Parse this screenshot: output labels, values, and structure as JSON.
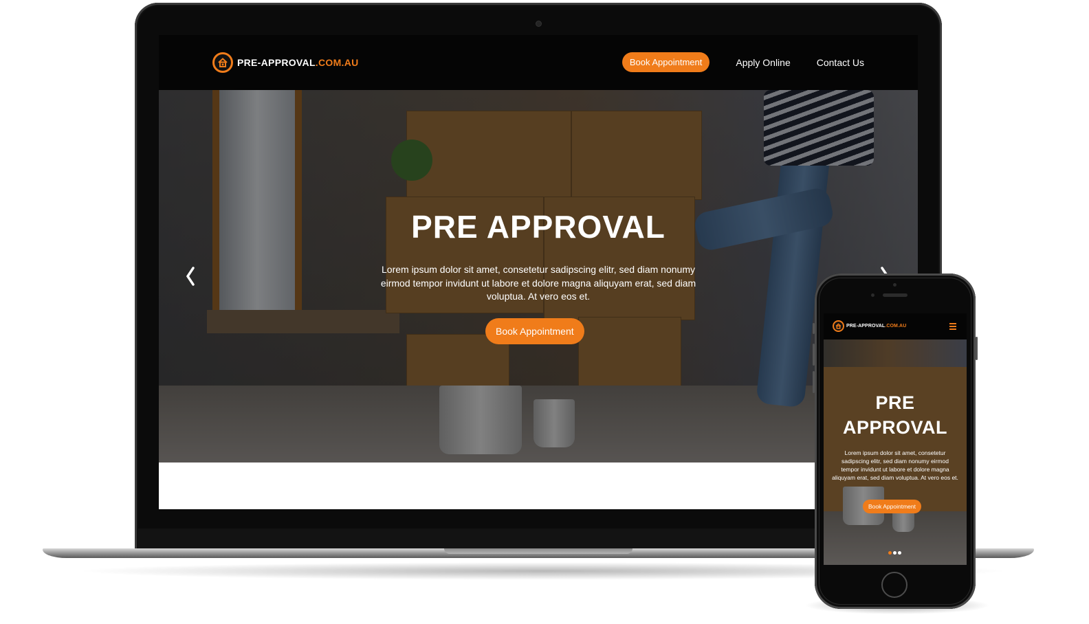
{
  "brand": {
    "name_main": "PRE-APPROVAL",
    "name_accent": ".COM.AU",
    "accent_color": "#f07c1a"
  },
  "nav": {
    "book_label": "Book Appointment",
    "apply_label": "Apply Online",
    "contact_label": "Contact Us"
  },
  "hero": {
    "title": "PRE APPROVAL",
    "description": "Lorem ipsum dolor sit amet, consetetur sadipscing elitr, sed diam nonumy eirmod tempor invidunt ut labore et dolore magna aliquyam erat, sed diam voluptua. At vero eos et.",
    "cta_label": "Book Appointment"
  },
  "mobile": {
    "title_line1": "PRE",
    "title_line2": "APPROVAL",
    "description": "Lorem ipsum dolor sit amet, consetetur sadipscing elitr, sed diam nonumy eirmod tempor invidunt ut labore et dolore magna aliquyam erat, sed diam voluptua. At vero eos et.",
    "cta_label": "Book Appointment",
    "menu_icon": "hamburger-icon",
    "active_dot_color": "#f07c1a",
    "dot_color": "#ffffff"
  },
  "icons": {
    "logo": "house-icon",
    "prev": "chevron-left-icon",
    "next": "chevron-right-icon"
  }
}
